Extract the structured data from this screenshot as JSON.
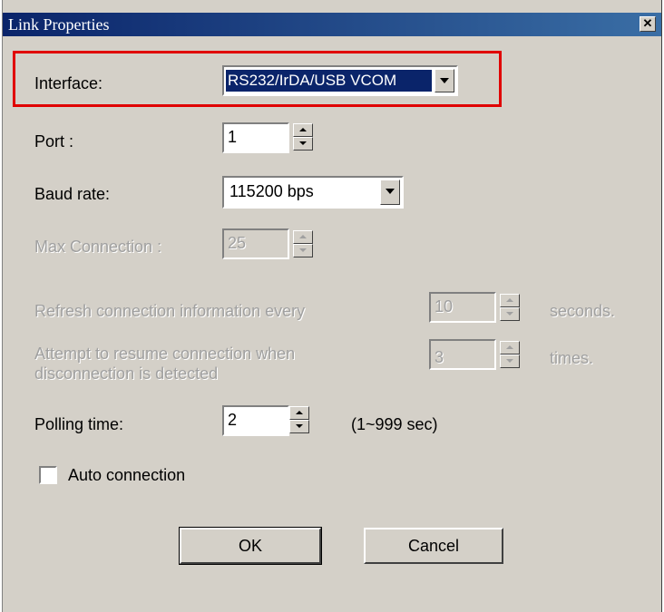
{
  "window": {
    "title": "Link Properties",
    "close_icon": "close-icon"
  },
  "interface": {
    "label": "Interface:",
    "value": "RS232/IrDA/USB VCOM"
  },
  "port": {
    "label": "Port :",
    "value": "1"
  },
  "baud_rate": {
    "label": "Baud rate:",
    "value": "115200 bps"
  },
  "max_connection": {
    "label": "Max Connection :",
    "value": "25"
  },
  "refresh": {
    "label": "Refresh connection information every",
    "value": "10",
    "unit": "seconds."
  },
  "resume": {
    "label_line1": "Attempt to resume connection when",
    "label_line2": "disconnection is detected",
    "value": "3",
    "unit": "times."
  },
  "polling": {
    "label": "Polling time:",
    "value": "2",
    "range": "(1~999 sec)"
  },
  "auto_connection": {
    "label": "Auto connection",
    "checked": false
  },
  "buttons": {
    "ok": "OK",
    "cancel": "Cancel"
  },
  "colors": {
    "highlight": "#e00000",
    "titlebar": "#0a246a",
    "dialog_bg": "#d4d0c8"
  }
}
